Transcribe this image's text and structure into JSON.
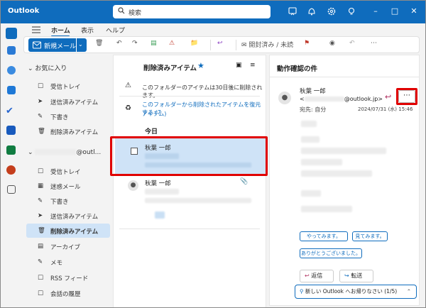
{
  "window": {
    "app_title": "Outlook"
  },
  "search": {
    "placeholder": "検索"
  },
  "menu": {
    "tabs": [
      "ホーム",
      "表示",
      "ヘルプ"
    ]
  },
  "toolbar": {
    "new_mail": "新規メール",
    "read_unread": "開封済み / 未読"
  },
  "folders": {
    "favorites_header": "お気に入り",
    "favorites": [
      "受信トレイ",
      "送信済みアイテム",
      "下書き",
      "削除済みアイテム"
    ],
    "account_header": "@outl...",
    "account_items": [
      "受信トレイ",
      "迷惑メール",
      "下書き",
      "送信済みアイテム",
      "削除済みアイテム",
      "アーカイブ",
      "メモ",
      "RSS フィード",
      "会話の履歴"
    ]
  },
  "list": {
    "title": "削除済みアイテム",
    "notice1": "このフォルダーのアイテムは30日後に削除されます。",
    "notice2_line1": "このフォルダーから削除されたアイテムを復元する (7",
    "notice2_line2": "アイテム)",
    "group_today": "今日",
    "items": [
      {
        "sender": "秋葉 一郎"
      },
      {
        "sender": "秋葉 一郎"
      }
    ]
  },
  "reading": {
    "subject": "動作確認の件",
    "sender": "秋葉 一郎",
    "address_prefix": "<",
    "address_suffix": "@outlook.jp>",
    "to_line": "宛先: 自分",
    "date": "2024/07/31 (水) 15:46",
    "chips": [
      "やってみます。",
      "見てみます。",
      "ありがとうございました。"
    ],
    "reply": "返信",
    "forward": "転送",
    "promo": "新しい Outlook へお帰りなさい (1/5)"
  },
  "colors": {
    "accent": "#0f6cbd",
    "highlight": "#e00000",
    "selected": "#cfe3f7"
  }
}
